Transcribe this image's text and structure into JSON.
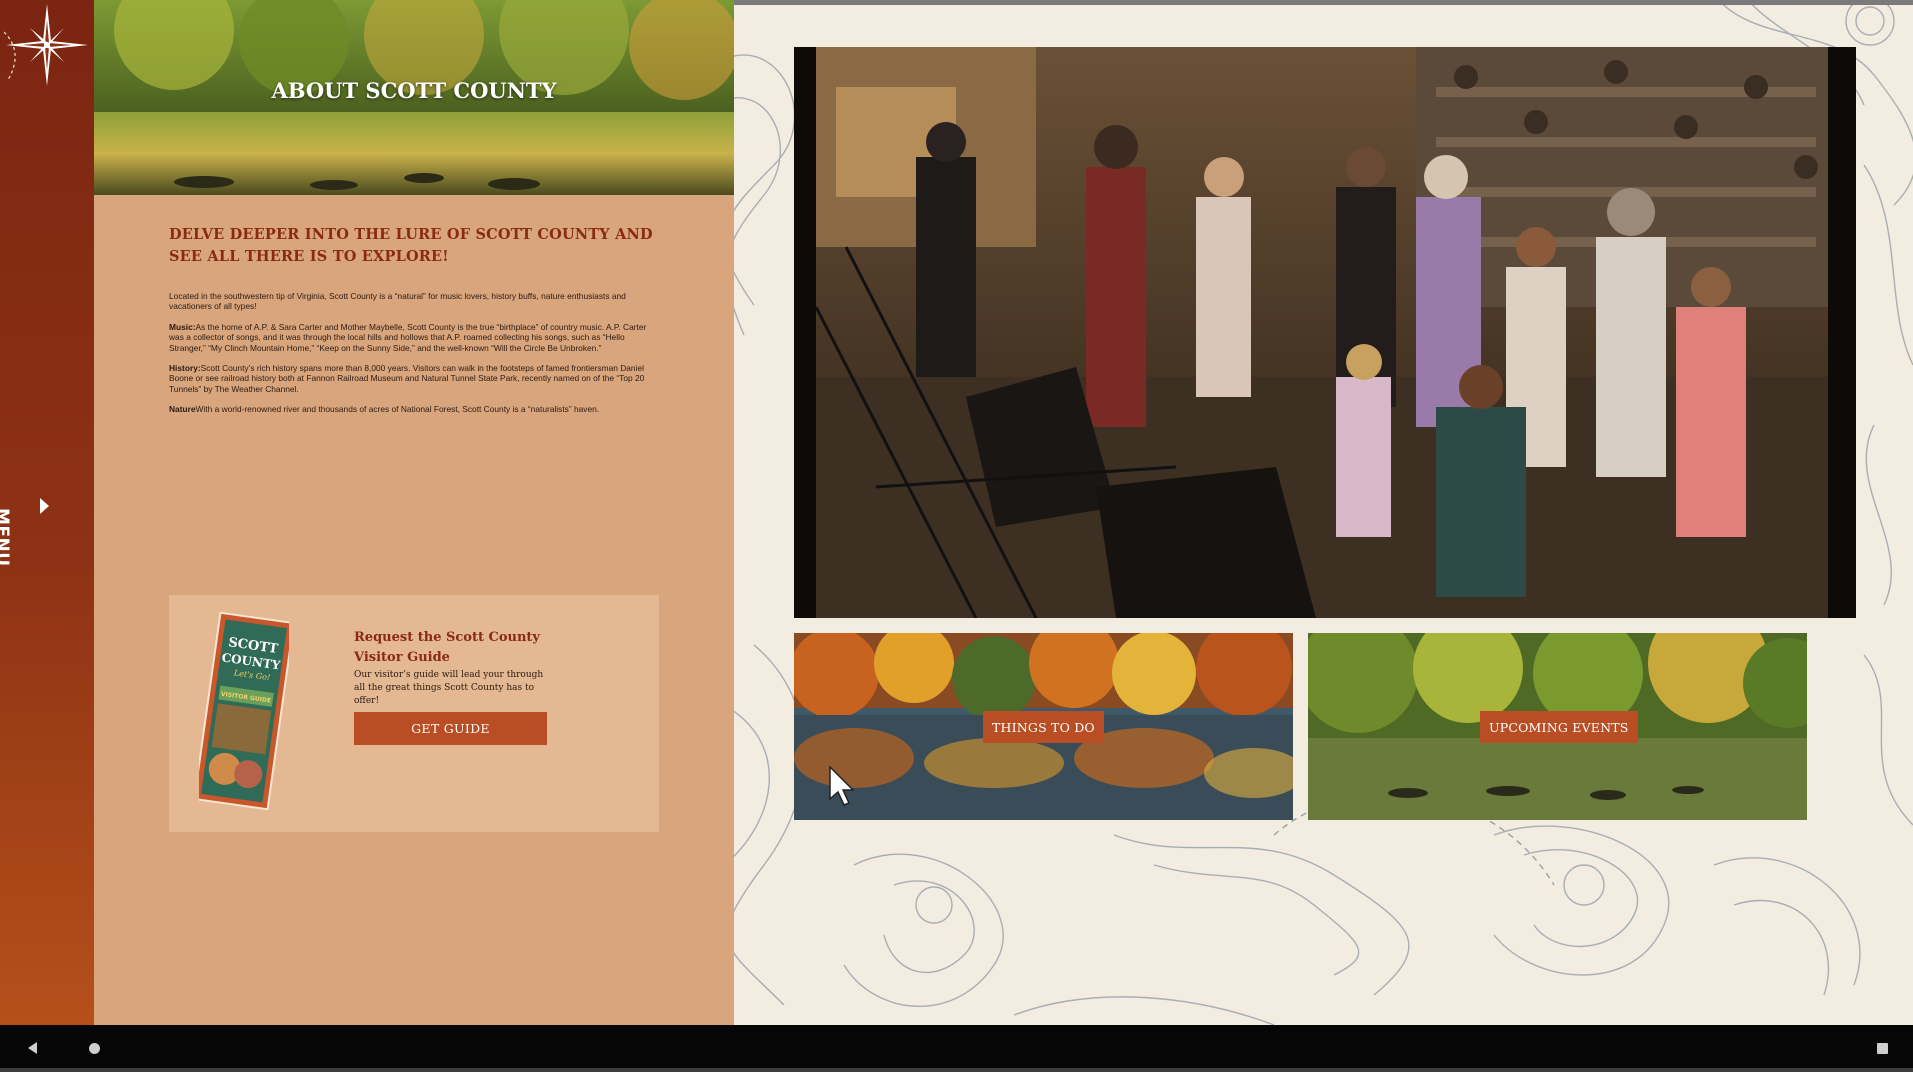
{
  "page": {
    "hero_title": "ABOUT SCOTT COUNTY",
    "headline": "DELVE DEEPER INTO THE LURE OF SCOTT COUNTY AND SEE ALL THERE IS TO EXPLORE!",
    "intro": "Located in the southwestern tip of Virginia, Scott County is a “natural” for music lovers, history buffs, nature enthusiasts and vacationers of all types!",
    "music": {
      "label": "Music:",
      "text": "As the home of A.P. & Sara Carter and Mother Maybelle, Scott County is the true “birthplace” of country music. A.P. Carter was a collector of songs, and it was through the local hills and hollows that A.P. roamed collecting his songs, such as “Hello Stranger,” “My Clinch Mountain Home,” “Keep on the Sunny Side,” and the well-known “Will the Circle Be Unbroken.”"
    },
    "history": {
      "label": "History:",
      "text": "Scott County’s rich history spans more than 8,000 years. Visitors can walk in the footsteps of famed frontiersman Daniel Boone or see railroad history both at Fannon Railroad Museum and Natural Tunnel State Park, recently named on of the “Top 20 Tunnels” by The Weather Channel."
    },
    "nature": {
      "label": "Nature",
      "text": "With a world-renowned river and thousands of acres of National Forest, Scott County is a “naturalists” haven."
    }
  },
  "sidebar": {
    "menu_label": "MENU",
    "compass_icon": "compass-rose-icon"
  },
  "guide": {
    "title": "Request the Scott County Visitor Guide",
    "description": "Our visitor’s guide will lead your through all the great things Scott County has to offer!",
    "button_label": "GET GUIDE",
    "brochure": {
      "line1": "SCOTT",
      "line2": "COUNTY",
      "tagline": "Let's Go!",
      "subtitle": "VISITOR GUIDE"
    }
  },
  "tiles": {
    "things_to_do": "THINGS TO DO",
    "upcoming_events": "UPCOMING EVENTS"
  },
  "colors": {
    "sidebar": "#8e3215",
    "panel": "#d9a57d",
    "card": "#e4b892",
    "accent": "#b94e24",
    "headline": "#8a2a14",
    "background": "#f2ece1"
  },
  "system_nav": {
    "back_icon": "back-triangle-icon",
    "home_icon": "home-circle-icon",
    "recents_icon": "recents-square-icon"
  }
}
